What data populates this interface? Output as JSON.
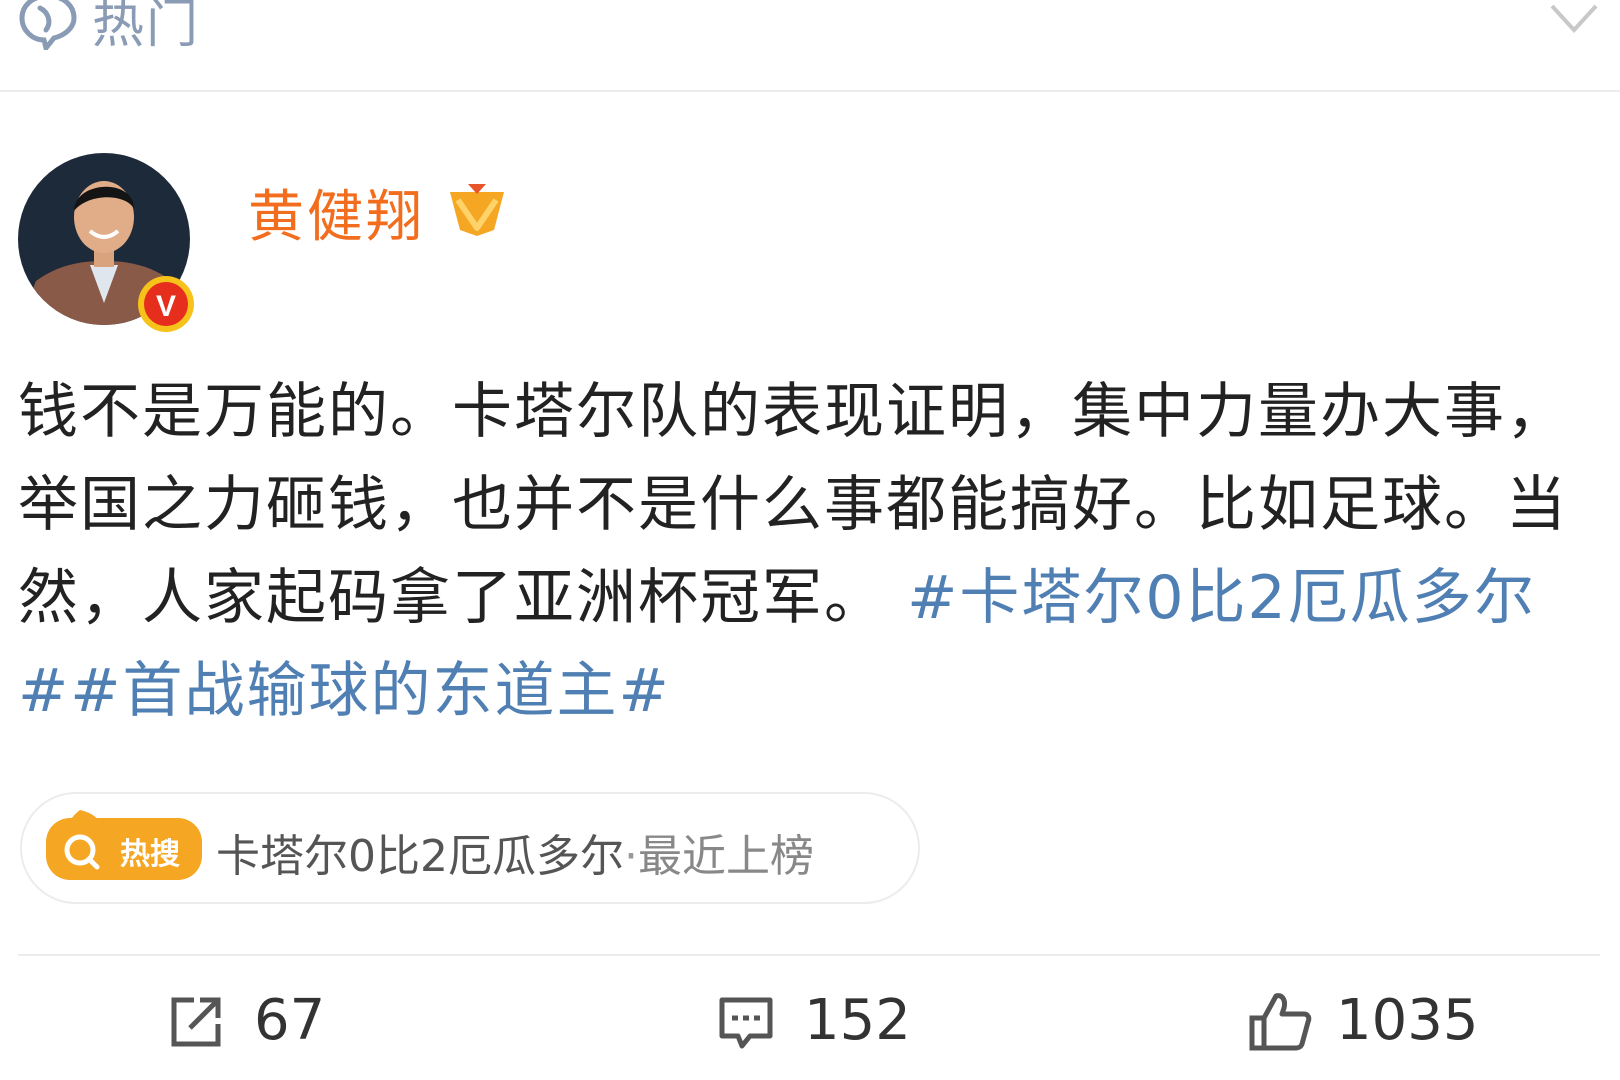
{
  "header": {
    "tab_label": "热门",
    "icons": {
      "tab": "hot-bubble-icon",
      "collapse": "chevron-down-icon"
    }
  },
  "author": {
    "name": "黄健翔",
    "verified_badge": "V",
    "icons": {
      "verified": "verified-v-icon",
      "member": "member-badge-icon"
    }
  },
  "post": {
    "text": "钱不是万能的。卡塔尔队的表现证明，集中力量办大事，举国之力砸钱，也并不是什么事都能搞好。比如足球。当然，人家起码拿了亚洲杯冠军。",
    "hashtags": [
      "#卡塔尔0比2厄瓜多尔#",
      "#首战输球的东道主#"
    ]
  },
  "hot_search": {
    "badge_text": "热搜",
    "topic": "卡塔尔0比2厄瓜多尔",
    "separator": "·",
    "tag": "最近上榜",
    "icons": {
      "badge": "hot-search-badge-icon"
    }
  },
  "actions": {
    "repost_count": "67",
    "comment_count": "152",
    "like_count": "1035",
    "icons": {
      "repost": "repost-icon",
      "comment": "comment-icon",
      "like": "thumbs-up-icon"
    }
  },
  "colors": {
    "author_name": "#f26d1e",
    "hashtag": "#4f7fb3",
    "header_tab": "#8a9bb5",
    "hot_badge": "#f5a623"
  }
}
